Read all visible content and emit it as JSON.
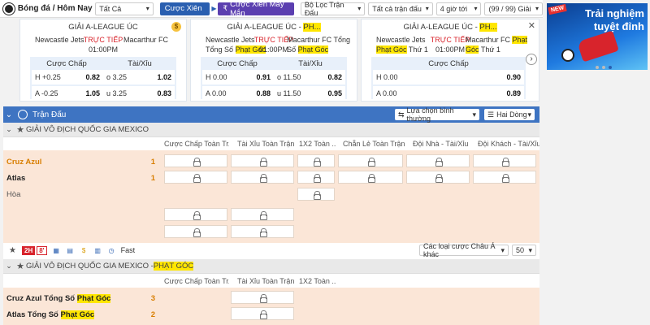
{
  "topbar": {
    "title": "Bóng đá / Hôm Nay",
    "filter_all": "Tất Cả",
    "btn_parlay": "Cược Xiên",
    "btn_lucky_parlay": "Cược Xiên May Mắn",
    "league_filter": "Bộ Lọc Trận Đấu",
    "match_filter": "Tất cả trận đấu",
    "time_filter": "4 giờ tới",
    "count": "(99 / 99) Giải"
  },
  "cards": [
    {
      "league": "GIẢI A-LEAGUE ÚC",
      "home": "Newcastle Jets",
      "away": "Macarthur FC",
      "live": "TRỰC TIẾP",
      "time": "01:00PM",
      "handicap_label": "Cược Chấp",
      "ou_label": "Tài/Xỉu",
      "rows": [
        {
          "h_label": "H",
          "h_line": "+0.25",
          "h_odds": "0.82",
          "o_label": "o",
          "o_line": "3.25",
          "o_odds": "1.02"
        },
        {
          "h_label": "A",
          "h_line": "-0.25",
          "h_odds": "1.05",
          "o_label": "u",
          "o_line": "3.25",
          "o_odds": "0.83"
        }
      ]
    },
    {
      "league_a": "GIẢI A-LEAGUE ÚC - ",
      "league_b": "PH...",
      "home_a": "Newcastle Jets",
      "home_b": "Tổng Số ",
      "home_c": "Phạt Góc",
      "away_a": "Macarthur FC Tổng",
      "away_b": "Số ",
      "away_c": "Phạt Góc",
      "live": "TRỰC TIẾP",
      "time": "01:00PM",
      "handicap_label": "Cược Chấp",
      "ou_label": "Tài/Xỉu",
      "rows": [
        {
          "h_label": "H",
          "h_line": "0.00",
          "h_odds": "0.91",
          "o_label": "o",
          "o_line": "11.50",
          "o_odds": "0.82"
        },
        {
          "h_label": "A",
          "h_line": "0.00",
          "h_odds": "0.88",
          "o_label": "u",
          "o_line": "11.50",
          "o_odds": "0.95"
        }
      ]
    },
    {
      "league_a": "GIẢI A-LEAGUE ÚC - ",
      "league_b": "PH...",
      "home_a": "Newcastle Jets",
      "home_b": "Phạt Góc",
      "home_c": " Thứ 1",
      "away_a": "Macarthur FC ",
      "away_b": "Phạt",
      "away_c": "Góc",
      "away_d": " Thứ 1",
      "live": "TRỰC TIẾP",
      "time": "01:00PM",
      "handicap_label": "Cược Chấp",
      "rows": [
        {
          "h_label": "H",
          "h_line": "0.00",
          "h_odds": "0.90"
        },
        {
          "h_label": "A",
          "h_line": "0.00",
          "h_odds": "0.89"
        }
      ]
    }
  ],
  "banner": {
    "new_tag": "NEW",
    "line1": "Trải nghiệm",
    "line2": "tuyệt đỉnh"
  },
  "table": {
    "header_title": "Trận Đấu",
    "sort_select": "Lựa chọn bình thường",
    "lines_select": "Hai Dòng",
    "section1": "GIẢI VÔ ĐỊCH QUỐC GIA MEXICO",
    "columns": [
      "Cược Chấp Toàn Tr...",
      "Tài Xỉu Toàn Trận",
      "1X2 Toàn ...",
      "Chẵn Lẻ Toàn Trận",
      "Đội Nhà - Tài/Xỉu",
      "Đội Khách - Tài/Xỉu"
    ],
    "match1": {
      "home": "Cruz Azul",
      "home_score": "1",
      "away": "Atlas",
      "away_score": "1",
      "draw": "Hòa"
    },
    "toolbar": {
      "tag_2h": "2H",
      "tag_min": "8'",
      "fast": "Fast",
      "odds_type": "Các loại cược Châu Á khác",
      "page_size": "50"
    },
    "section2_a": "GIẢI VÔ ĐỊCH QUỐC GIA MEXICO - ",
    "section2_b": "PHẠT GÓC",
    "columns2": [
      "Cược Chấp Toàn Tr...",
      "Tài Xỉu Toàn Trận",
      "1X2 Toàn ..."
    ],
    "match2": {
      "home_a": "Cruz Azul Tổng Số ",
      "home_b": "Phạt Góc",
      "home_score": "3",
      "away_a": "Atlas Tổng Số ",
      "away_b": "Phạt Góc",
      "away_score": "2"
    }
  }
}
